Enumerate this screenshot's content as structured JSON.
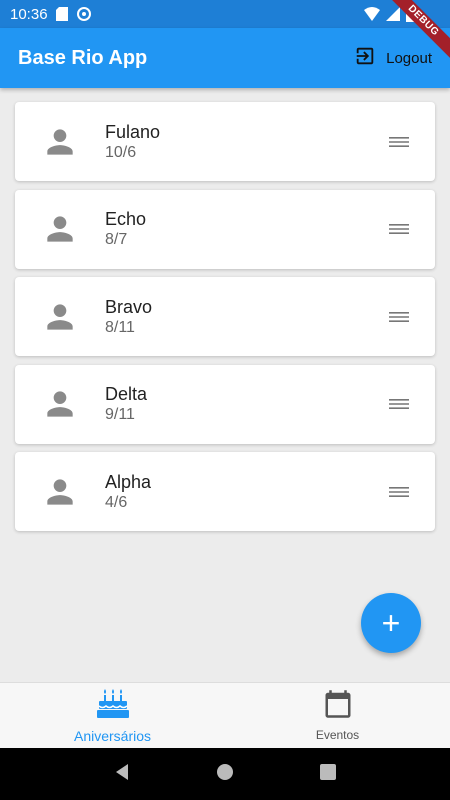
{
  "status_bar": {
    "time": "10:36",
    "debug_label": "DEBUG"
  },
  "app_bar": {
    "title": "Base Rio App",
    "logout_label": "Logout"
  },
  "list": {
    "items": [
      {
        "name": "Fulano",
        "date": "10/6"
      },
      {
        "name": "Echo",
        "date": "8/7"
      },
      {
        "name": "Bravo",
        "date": "8/11"
      },
      {
        "name": "Delta",
        "date": "9/11"
      },
      {
        "name": "Alpha",
        "date": "4/6"
      }
    ]
  },
  "fab": {
    "icon": "add-icon",
    "symbol": "+"
  },
  "bottom_nav": {
    "items": [
      {
        "label": "Aniversários",
        "icon": "cake-icon",
        "active": true
      },
      {
        "label": "Eventos",
        "icon": "calendar-icon",
        "active": false
      }
    ]
  },
  "colors": {
    "primary": "#2196f3",
    "status_bar": "#1e7fd6",
    "background": "#ececec",
    "avatar_gray": "#8a8a8a"
  }
}
